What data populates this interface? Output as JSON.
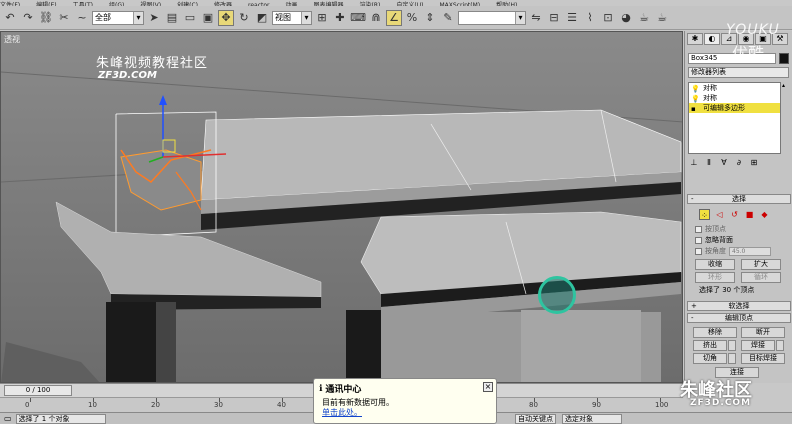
{
  "menu": [
    "文件(F)",
    "编辑(E)",
    "工具(T)",
    "组(G)",
    "视图(V)",
    "创建(C)",
    "修改器",
    "reactor",
    "动画",
    "图表编辑器",
    "渲染(R)",
    "自定义(U)",
    "MAXScript(M)",
    "帮助(H)"
  ],
  "toolbar": {
    "filter_value": "全部",
    "refcoord_value": "视图",
    "named_sel_value": ""
  },
  "viewport": {
    "label": "透视",
    "watermark_cn": "朱峰视频教程社区",
    "watermark_en": "ZF3D.COM"
  },
  "panel": {
    "object_name": "Box345",
    "object_color": "#111111",
    "modifier_list": "修改器列表",
    "stack": [
      {
        "label": "对称",
        "selected": false
      },
      {
        "label": "对称",
        "selected": false
      },
      {
        "label": "可编辑多边形",
        "selected": true
      }
    ],
    "selection_header": "选择",
    "by_vertex": "按顶点",
    "ignore_backfacing": "忽略背面",
    "by_angle": "按角度",
    "angle_value": "45.0",
    "shrink": "收缩",
    "grow": "扩大",
    "ring": "环形",
    "loop": "循环",
    "selection_status": "选择了 30 个顶点",
    "soft_selection_header": "软选择",
    "edit_vertices_header": "编辑顶点",
    "remove": "移除",
    "break": "断开",
    "extrude": "挤出",
    "weld": "焊接",
    "chamfer": "切角",
    "target_weld": "目标焊接",
    "connect": "连接"
  },
  "timeline": {
    "frame_display": "0 / 100",
    "ticks": [
      "0",
      "10",
      "20",
      "30",
      "40",
      "50",
      "60",
      "70",
      "80",
      "90",
      "100"
    ]
  },
  "status": {
    "selected_text": "选择了 1 个对象",
    "auto_key": "自动关键点",
    "selected_obj": "选定对象"
  },
  "popup": {
    "title": "通讯中心",
    "message": "目前有新数据可用。",
    "link": "单击此处。"
  },
  "logos": {
    "top_right_1": "YOUKU",
    "top_right_2": "优酷",
    "bottom_right_1": "朱峰社区",
    "bottom_right_2": "ZF3D.COM"
  }
}
